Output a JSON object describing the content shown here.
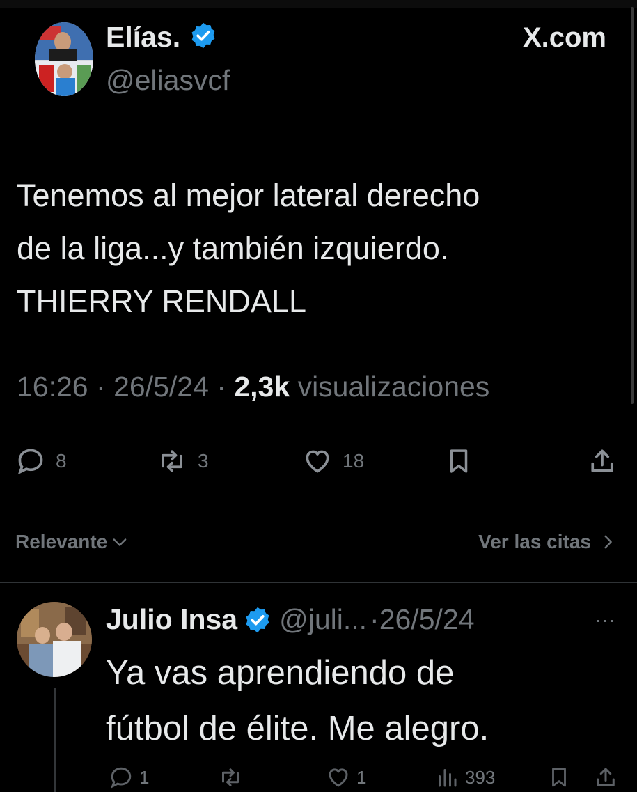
{
  "header": {
    "site_label": "X.com"
  },
  "tweet": {
    "author_name": "Elías.",
    "author_handle": "@eliasvcf",
    "text_lines": [
      "Tenemos al mejor lateral derecho",
      "de la liga...y también izquierdo.",
      "THIERRY RENDALL"
    ],
    "time": "16:26",
    "date": "26/5/24",
    "views_count": "2,3k",
    "views_label": "visualizaciones",
    "separator": "·",
    "actions": {
      "replies": "8",
      "retweets": "3",
      "likes": "18"
    }
  },
  "replies_bar": {
    "sort_label": "Relevante",
    "quotes_label": "Ver las citas"
  },
  "reply": {
    "author_name": "Julio Insa",
    "author_handle": "@juli...",
    "date_text": "·26/5/24",
    "more": "···",
    "text_lines": [
      "Ya vas aprendiendo de",
      "fútbol de élite. Me alegro."
    ],
    "actions": {
      "replies": "1",
      "likes": "1",
      "views": "393"
    }
  },
  "colors": {
    "background": "#000000",
    "text": "#e7e9ea",
    "muted": "#71767b",
    "verified": "#1d9bf0"
  },
  "icons": [
    "verified-badge-icon",
    "reply-icon",
    "retweet-icon",
    "like-icon",
    "bookmark-icon",
    "share-icon",
    "chevron-down-icon",
    "chevron-right-icon",
    "views-icon",
    "more-icon"
  ]
}
